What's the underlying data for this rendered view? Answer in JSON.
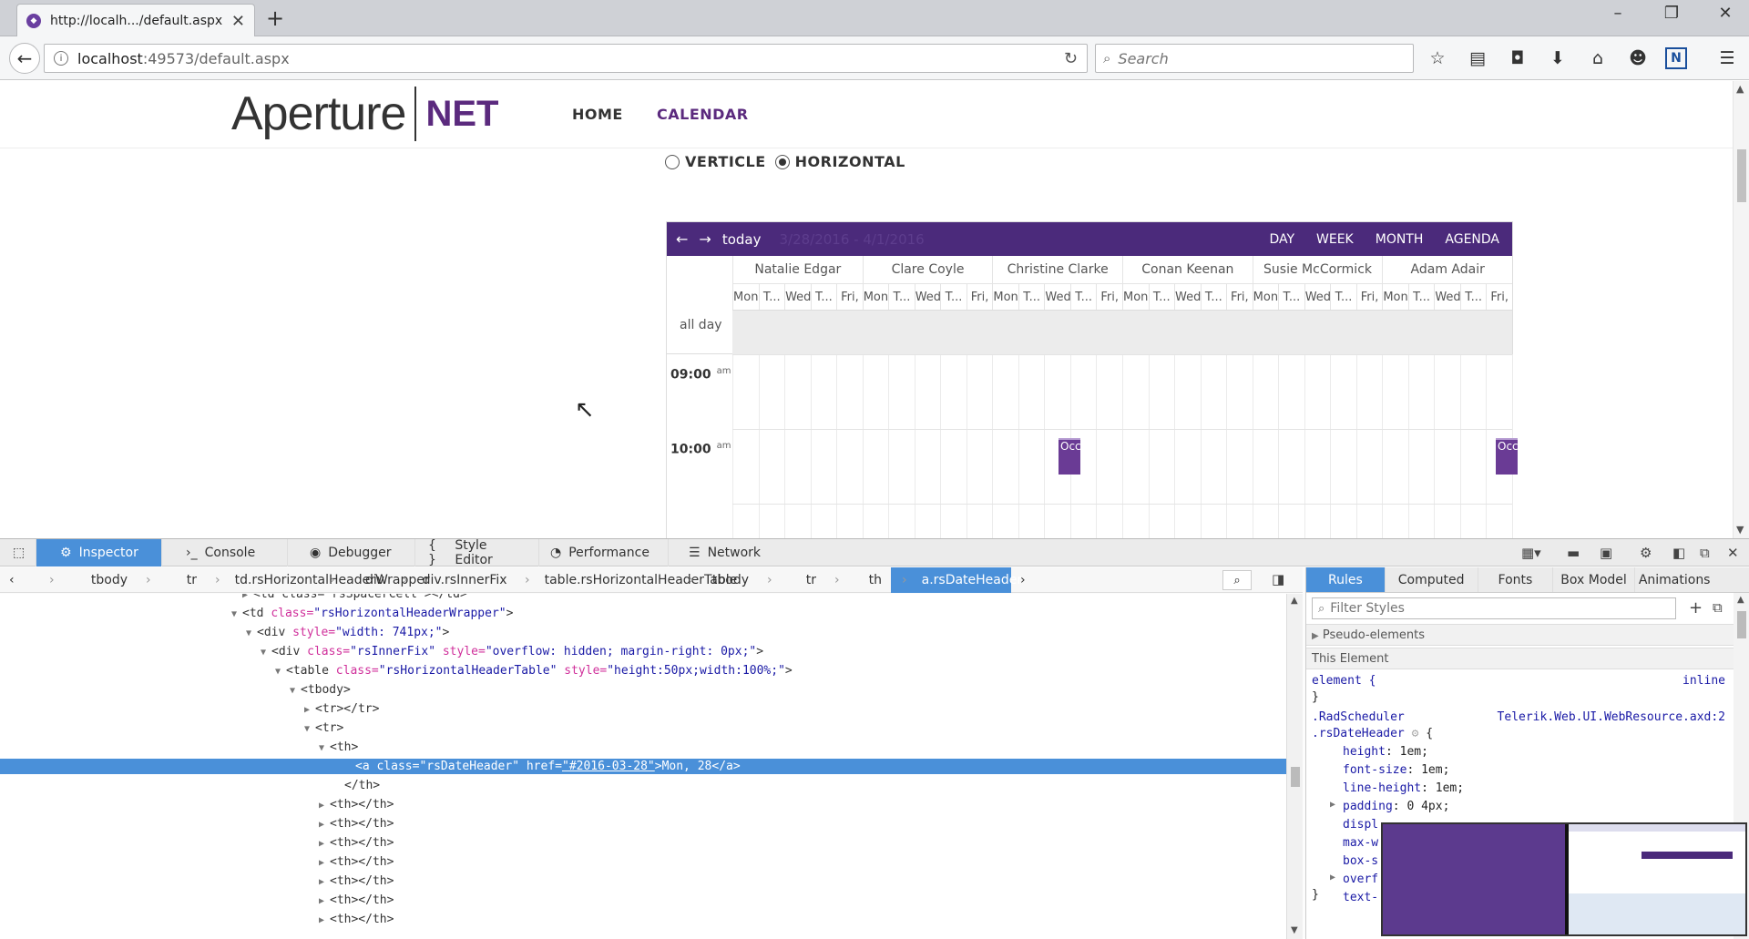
{
  "browser": {
    "tab_title": "http://localh.../default.aspx",
    "url_host": "localhost",
    "url_path": ":49573/default.aspx",
    "search_placeholder": "Search"
  },
  "site": {
    "logo_text": "Aperture",
    "logo_suffix": "NET",
    "nav": [
      "HOME",
      "CALENDAR"
    ],
    "orientation_options": [
      "VERTICLE",
      "HORIZONTAL"
    ],
    "orientation_selected": "HORIZONTAL"
  },
  "scheduler": {
    "today_label": "today",
    "date_range": "3/28/2016 - 4/1/2016",
    "views": [
      "DAY",
      "WEEK",
      "MONTH",
      "AGENDA"
    ],
    "resources": [
      "Natalie Edgar",
      "Clare Coyle",
      "Christine Clarke",
      "Conan Keenan",
      "Susie McCormick",
      "Adam Adair"
    ],
    "days": [
      "Mon",
      "T...",
      "Wed",
      "T...",
      "Fri,"
    ],
    "allday_label": "all day",
    "times": [
      {
        "t": "09:00",
        "ampm": "am"
      },
      {
        "t": "10:00",
        "ampm": "am"
      }
    ],
    "appointments": [
      {
        "label": "Occ"
      },
      {
        "label": "Occ"
      }
    ]
  },
  "devtools": {
    "tabs": [
      "Inspector",
      "Console",
      "Debugger",
      "Style Editor",
      "Performance",
      "Network"
    ],
    "active_tab": "Inspector",
    "breadcrumbs": [
      "tbody",
      "tr",
      "td.rsHorizontalHeaderWrapper",
      "div",
      "div.rsInnerFix",
      "table.rsHorizontalHeaderTable",
      "tbody",
      "tr",
      "th",
      "a.rsDateHeader"
    ],
    "markup": {
      "l0": "<td class=\"rsSpacerCell\"></td>",
      "l1_tag": "<td ",
      "l1_attr": "class=",
      "l1_val": "\"rsHorizontalHeaderWrapper\"",
      "l2_attr": "style=",
      "l2_val": "\"width: 741px;\"",
      "l3_attr1": "class=",
      "l3_val1": "\"rsInnerFix\"",
      "l3_attr2": "style=",
      "l3_val2": "\"overflow: hidden; margin-right: 0px;\"",
      "l4_attr1": "class=",
      "l4_val1": "\"rsHorizontalHeaderTable\"",
      "l4_attr2": "style=",
      "l4_val2": "\"height:50px;width:100%;\"",
      "l5": "<tbody>",
      "l6": "<tr></tr>",
      "l7": "<tr>",
      "l8": "<th>",
      "sel_tag": "<a ",
      "sel_attr1": "class=",
      "sel_val1": "\"rsDateHeader\"",
      "sel_attr2": "href=",
      "sel_val2": "\"#2016-03-28\"",
      "sel_text": ">Mon, 28</a>",
      "l10": "</th>",
      "th_collapsed": "<th></th>"
    },
    "rules_tabs": [
      "Rules",
      "Computed",
      "Fonts",
      "Box Model",
      "Animations"
    ],
    "filter_placeholder": "Filter Styles",
    "pseudo_elements": "Pseudo-elements",
    "this_element": "This Element",
    "element_rule": "element {",
    "element_rule_close": "}",
    "inline_label": "inline",
    "selector_1": ".RadScheduler",
    "selector_2": ".rsDateHeader",
    "source": "Telerik.Web.UI.WebResource.axd:2",
    "open_brace": "{",
    "props": [
      {
        "n": "height",
        "v": "1em;"
      },
      {
        "n": "font-size",
        "v": "1em;"
      },
      {
        "n": "line-height",
        "v": "1em;"
      },
      {
        "n": "padding",
        "v": "0 4px;"
      },
      {
        "n": "displ",
        "v": ""
      },
      {
        "n": "max-w",
        "v": ""
      },
      {
        "n": "box-s",
        "v": ""
      },
      {
        "n": "overf",
        "v": ""
      },
      {
        "n": "text-",
        "v": ""
      }
    ],
    "close_brace": "}"
  },
  "colors": {
    "brand": "#4b2a7b",
    "accent": "#4a90d9"
  }
}
